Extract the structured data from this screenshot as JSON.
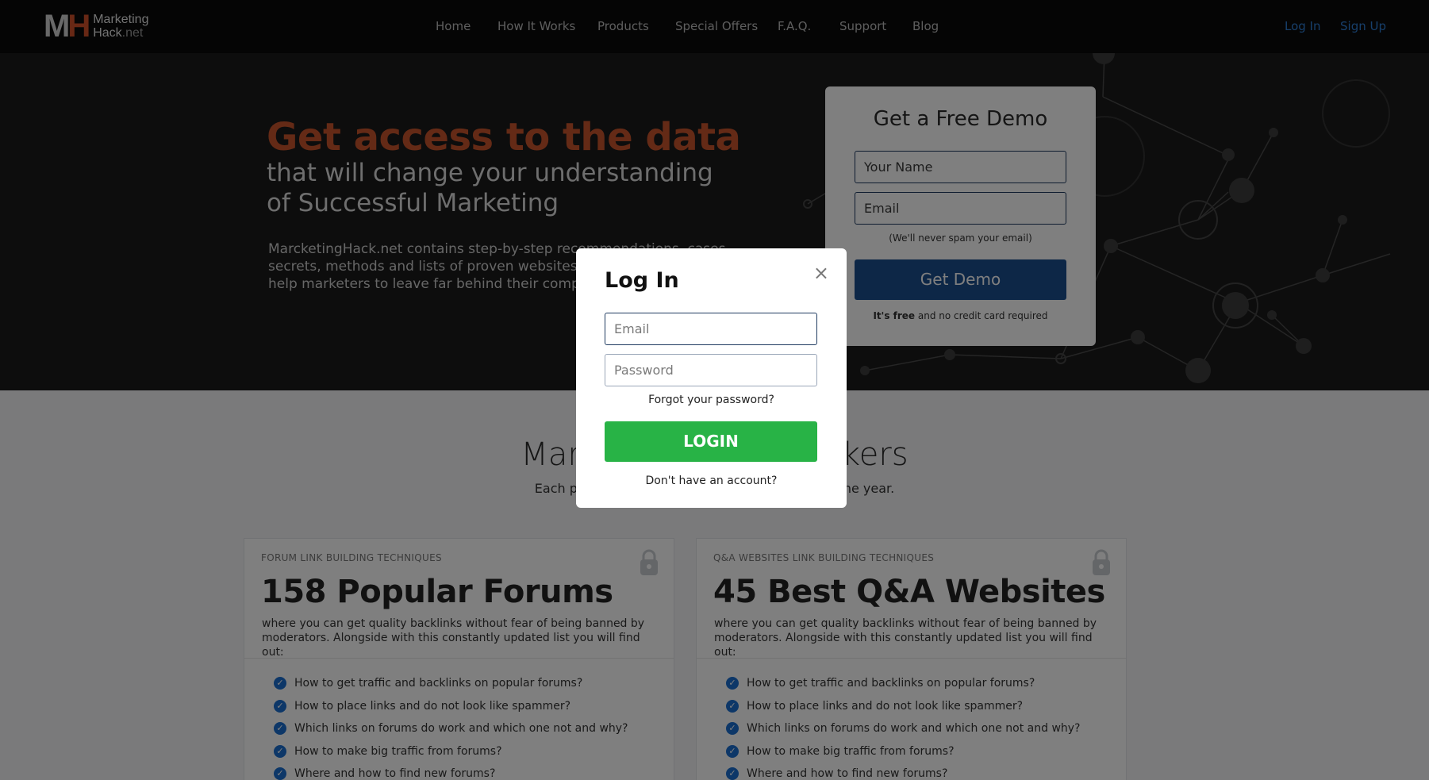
{
  "brand": {
    "mark_m": "M",
    "mark_h": "H",
    "line1": "Marketing",
    "line2_name": "Hack",
    "line2_tld": ".net"
  },
  "nav": {
    "items": [
      "Home",
      "How It Works",
      "Products",
      "Special Offers",
      "F.A.Q.",
      "Support",
      "Blog"
    ],
    "login": "Log In",
    "signup": "Sign Up"
  },
  "hero": {
    "headline": "Get access to the data",
    "subheadline": "that will change your understanding of Successful Marketing",
    "paragraph": "MarcketingHack.net contains step-by-step recommendations, cases, secrets, methods and lists of proven websites. This information will help marketers to leave far behind their competitors."
  },
  "demo": {
    "title": "Get a Free Demo",
    "name_placeholder": "Your Name",
    "email_placeholder": "Email",
    "note": "(We'll never spam your email)",
    "button": "Get Demo",
    "free_bold": "It's free",
    "free_rest": " and no credit card required"
  },
  "section": {
    "title": "Marketing Hack Trackers",
    "subtitle": "Each product is constantly updated throughout the year."
  },
  "cards": [
    {
      "tag": "FORUM LINK BUILDING TECHNIQUES",
      "title": "158 Popular Forums",
      "desc": "where you can get quality backlinks without fear of being banned by moderators. Alongside with this constantly updated list you will find out:",
      "items": [
        "How to get traffic and backlinks on popular forums?",
        "How to place links and do not look like spammer?",
        "Which links on forums do work and which one not and why?",
        "How to make big traffic from forums?",
        "Where and how to find new forums?"
      ]
    },
    {
      "tag": "Q&A WEBSITES LINK BUILDING TECHNIQUES",
      "title": "45 Best Q&A Websites",
      "desc": "where you can get quality backlinks without fear of being banned by moderators. Alongside with this constantly updated list you will find out:",
      "items": [
        "How to get traffic and backlinks on popular forums?",
        "How to place links and do not look like spammer?",
        "Which links on forums do work and which one not and why?",
        "How to make big traffic from forums?",
        "Where and how to find new forums?"
      ]
    }
  ],
  "modal": {
    "title": "Log In",
    "close": "×",
    "email_placeholder": "Email",
    "password_placeholder": "Password",
    "forgot": "Forgot your password?",
    "button": "LOGIN",
    "no_account": "Don't have an account?"
  },
  "colors": {
    "accent_orange": "#c8552c",
    "link_blue": "#2f7fd6",
    "demo_blue": "#1b4f8f",
    "login_green": "#28b346"
  }
}
